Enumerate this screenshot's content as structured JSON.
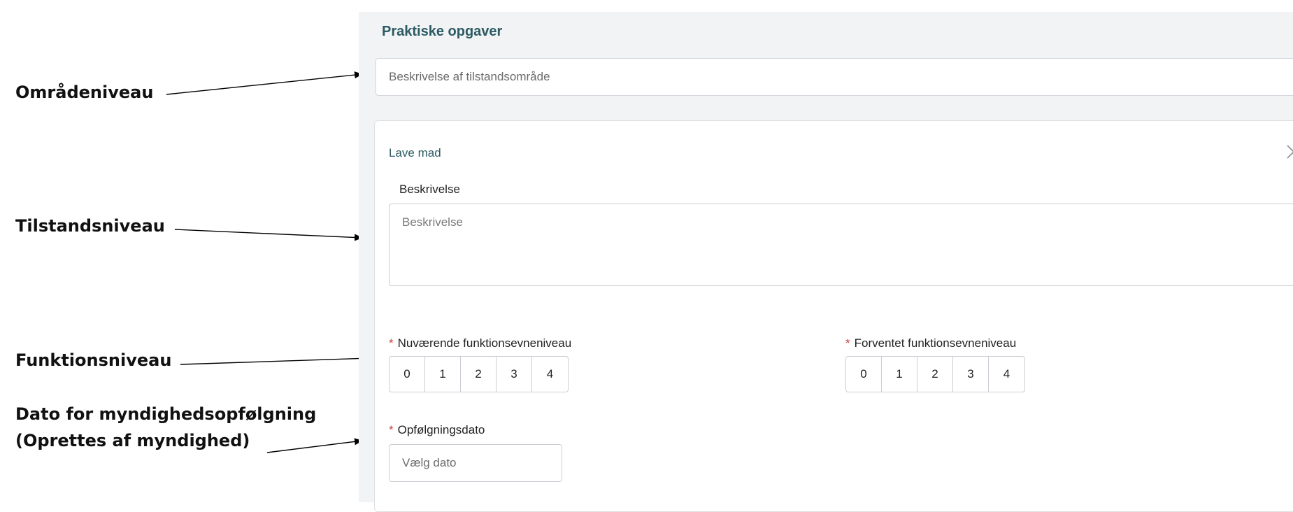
{
  "annotations": {
    "area_level": "Områdeniveau",
    "state_level": "Tilstandsniveau",
    "function_level": "Funktionsniveau",
    "follow_up_line1": "Dato for myndighedsopfølgning",
    "follow_up_line2": "(Oprettes af myndighed)"
  },
  "section": {
    "title": "Praktiske opgaver",
    "area_description_placeholder": "Beskrivelse af tilstandsområde"
  },
  "card": {
    "title": "Lave mad",
    "close_icon": "close-icon",
    "description_label": "Beskrivelse",
    "description_placeholder": "Beskrivelse",
    "required_mark": "*",
    "current_level_label": "Nuværende funktionsevneniveau",
    "expected_level_label": "Forventet funktionsevneniveau",
    "level_options": [
      "0",
      "1",
      "2",
      "3",
      "4"
    ],
    "follow_up_label": "Opfølgningsdato",
    "follow_up_placeholder": "Vælg dato"
  },
  "colors": {
    "panel_background": "#f2f3f5",
    "title_teal": "#2b5a62",
    "required_red": "#d23b3b"
  }
}
